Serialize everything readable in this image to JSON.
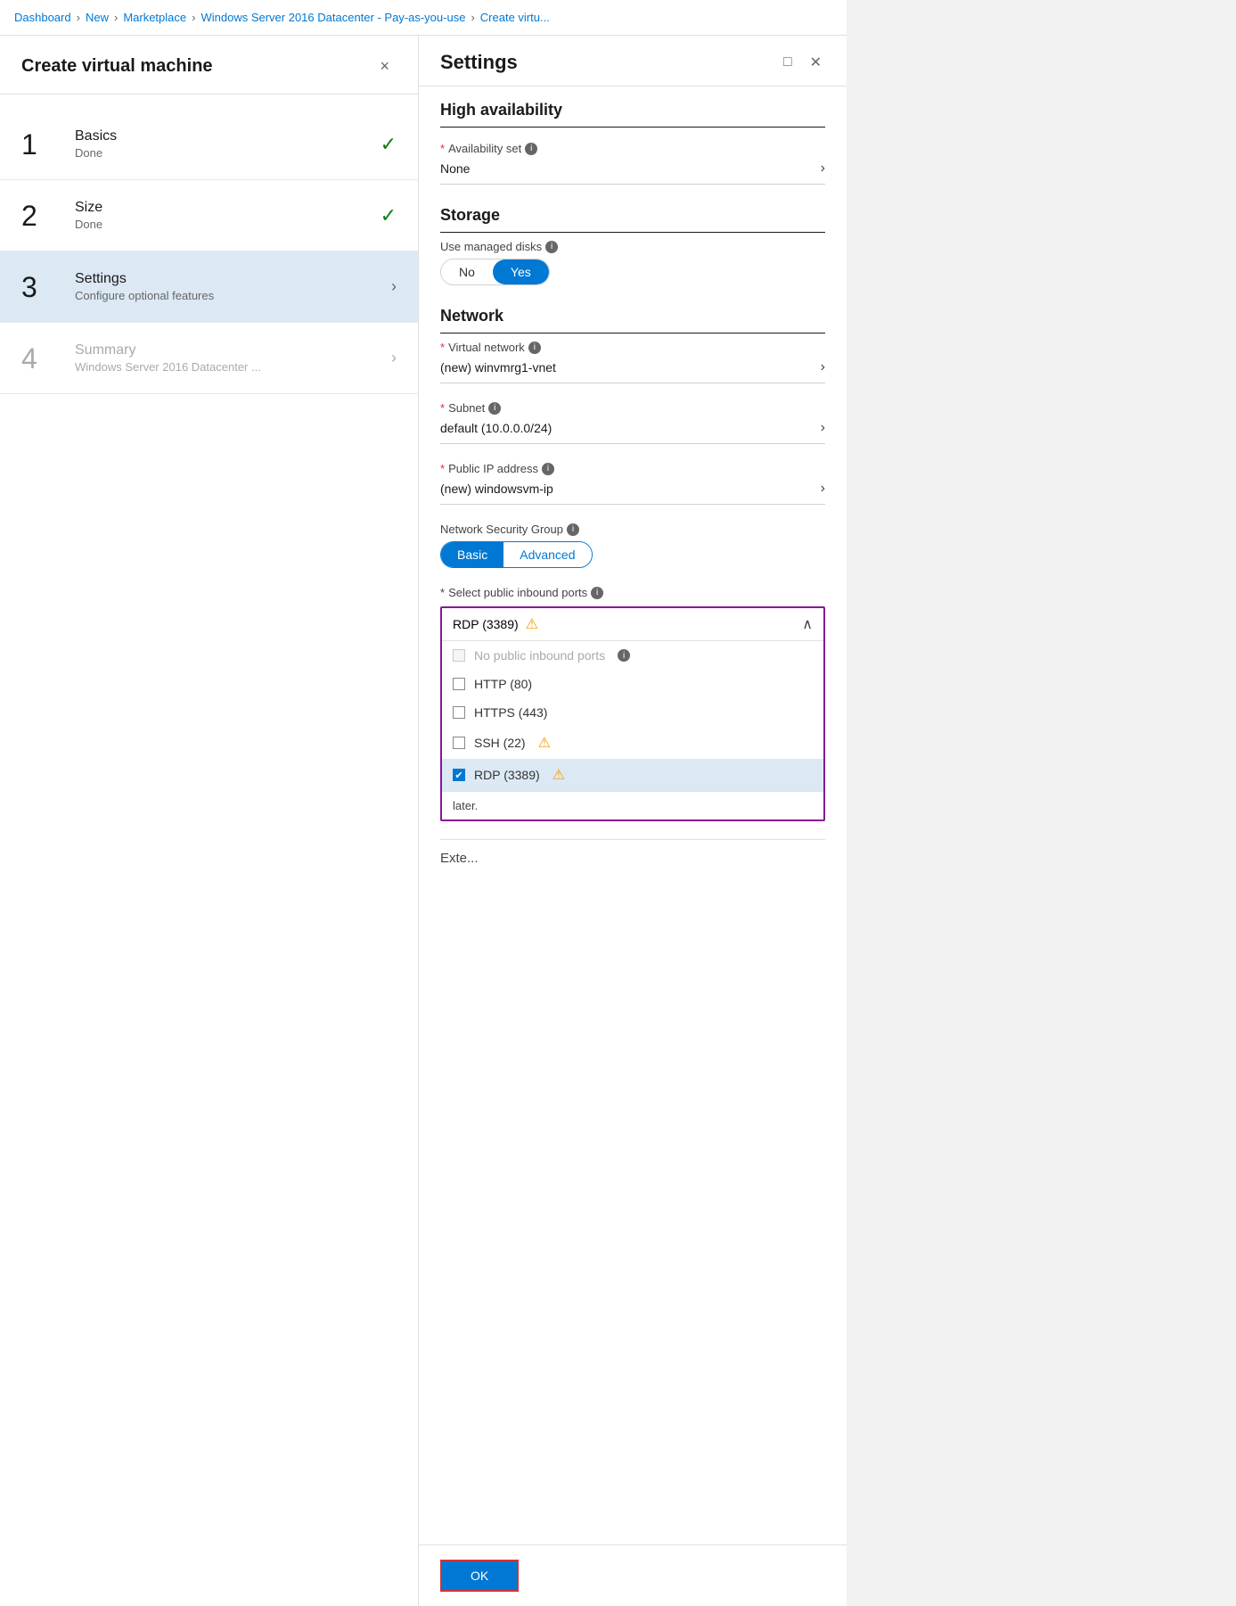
{
  "breadcrumb": {
    "items": [
      "Dashboard",
      "New",
      "Marketplace",
      "Windows Server 2016 Datacenter - Pay-as-you-use",
      "Create virtu..."
    ]
  },
  "left_panel": {
    "title": "Create virtual machine",
    "close_label": "×",
    "steps": [
      {
        "number": "1",
        "label": "Basics",
        "sublabel": "Done",
        "status": "done",
        "active": false
      },
      {
        "number": "2",
        "label": "Size",
        "sublabel": "Done",
        "status": "done",
        "active": false
      },
      {
        "number": "3",
        "label": "Settings",
        "sublabel": "Configure optional features",
        "status": "active",
        "active": true
      },
      {
        "number": "4",
        "label": "Summary",
        "sublabel": "Windows Server 2016 Datacenter ...",
        "status": "disabled",
        "active": false
      }
    ]
  },
  "right_panel": {
    "title": "Settings",
    "sections": {
      "high_availability": {
        "title": "High availability",
        "availability_set": {
          "label": "Availability set",
          "required": true,
          "value": "None"
        }
      },
      "storage": {
        "title": "Storage",
        "managed_disks": {
          "label": "Use managed disks",
          "options": [
            "No",
            "Yes"
          ],
          "selected": "Yes"
        }
      },
      "network": {
        "title": "Network",
        "virtual_network": {
          "label": "Virtual network",
          "required": true,
          "value": "(new) winvmrg1-vnet"
        },
        "subnet": {
          "label": "Subnet",
          "required": true,
          "value": "default (10.0.0.0/24)"
        },
        "public_ip": {
          "label": "Public IP address",
          "required": true,
          "value": "(new) windowsvm-ip"
        },
        "nsg": {
          "label": "Network Security Group",
          "options": [
            "Basic",
            "Advanced"
          ],
          "selected": "Basic"
        },
        "inbound_ports": {
          "label": "Select public inbound ports",
          "required": true,
          "selected_display": "RDP (3389)",
          "has_warning": true,
          "options": [
            {
              "id": "none",
              "label": "No public inbound ports",
              "checked": false,
              "disabled": true,
              "has_info": true
            },
            {
              "id": "http",
              "label": "HTTP (80)",
              "checked": false,
              "disabled": false,
              "has_info": false
            },
            {
              "id": "https",
              "label": "HTTPS (443)",
              "checked": false,
              "disabled": false,
              "has_info": false
            },
            {
              "id": "ssh",
              "label": "SSH (22)",
              "checked": false,
              "disabled": false,
              "has_info": false,
              "has_warning": true
            },
            {
              "id": "rdp",
              "label": "RDP (3389)",
              "checked": true,
              "disabled": false,
              "has_info": false,
              "has_warning": true
            }
          ],
          "later_text": "later."
        }
      }
    },
    "extension_section": {
      "label": "Exte..."
    },
    "footer": {
      "ok_label": "OK"
    }
  },
  "icons": {
    "check": "✓",
    "chevron_right": "›",
    "chevron_up": "∧",
    "close": "✕",
    "info": "i",
    "warning": "⚠",
    "checkmark": "✔",
    "maximize": "□"
  }
}
